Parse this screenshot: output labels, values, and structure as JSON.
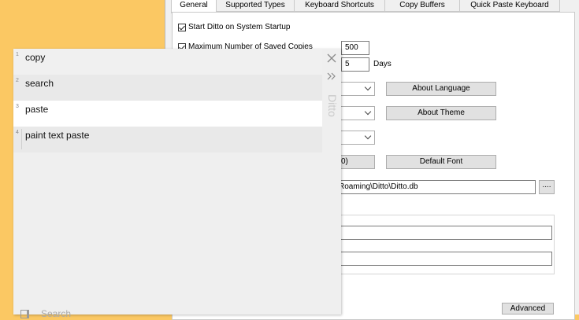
{
  "options": {
    "tabs": [
      {
        "label": "General",
        "active": true
      },
      {
        "label": "Supported Types",
        "active": false
      },
      {
        "label": "Keyboard Shortcuts",
        "active": false
      },
      {
        "label": "Copy Buffers",
        "active": false
      },
      {
        "label": "Quick Paste Keyboard",
        "active": false
      }
    ],
    "start_on_startup": {
      "label": "Start Ditto on System Startup",
      "checked": true
    },
    "max_copies": {
      "label": "Maximum Number of Saved Copies",
      "value": "500",
      "checked": true
    },
    "expire": {
      "value": "5",
      "unit": "Days"
    },
    "about_language_button": "About Language",
    "about_theme_button": "About Theme",
    "font_value": "0)",
    "default_font_button": "Default Font",
    "db_path": "Roaming\\Ditto\\Ditto.db",
    "browse_button": "....",
    "advanced_button": "Advanced"
  },
  "ditto": {
    "title": "Ditto",
    "clips": [
      {
        "index": "1",
        "text": "copy"
      },
      {
        "index": "2",
        "text": "search"
      },
      {
        "index": "3",
        "text": "paste"
      },
      {
        "index": "4",
        "text": "paint text paste"
      }
    ],
    "search_label": "Search"
  },
  "colors": {
    "desktop": "#fbc863",
    "dialog": "#f0f0f0",
    "popup": "#efefef",
    "selected_row": "#ffffff"
  }
}
